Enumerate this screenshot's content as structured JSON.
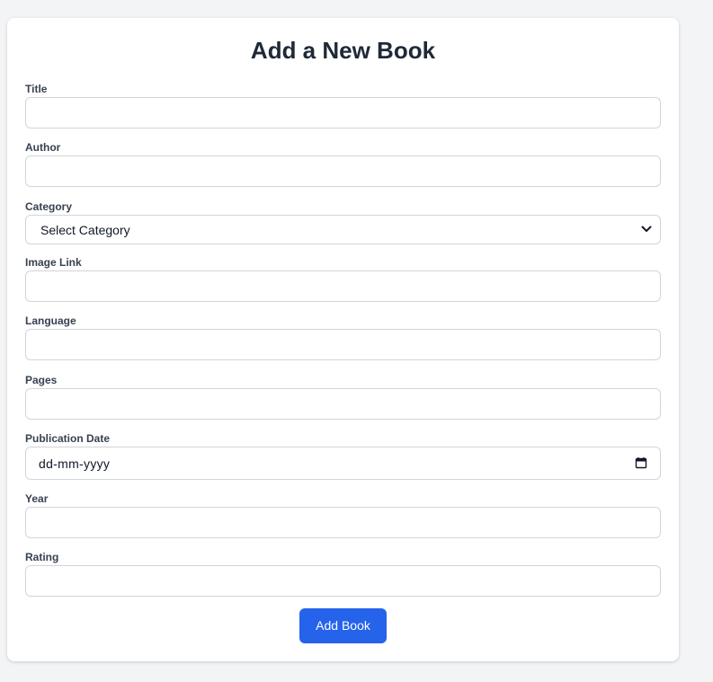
{
  "form": {
    "title": "Add a New Book",
    "fields": {
      "title": {
        "label": "Title",
        "value": ""
      },
      "author": {
        "label": "Author",
        "value": ""
      },
      "category": {
        "label": "Category",
        "selected": "Select Category"
      },
      "image_link": {
        "label": "Image Link",
        "value": ""
      },
      "language": {
        "label": "Language",
        "value": ""
      },
      "pages": {
        "label": "Pages",
        "value": ""
      },
      "publication_date": {
        "label": "Publication Date",
        "placeholder": "dd-mm-yyyy"
      },
      "year": {
        "label": "Year",
        "value": ""
      },
      "rating": {
        "label": "Rating",
        "value": ""
      }
    },
    "submit_label": "Add Book"
  },
  "icons": {
    "category_dropdown": "chevron-down-icon",
    "date_picker": "calendar-icon"
  },
  "colors": {
    "page_background": "#f3f4f6",
    "card_background": "#ffffff",
    "primary_button": "#2563eb",
    "heading_text": "#1f2937",
    "label_text": "#374151",
    "input_border": "#d1d5db"
  }
}
